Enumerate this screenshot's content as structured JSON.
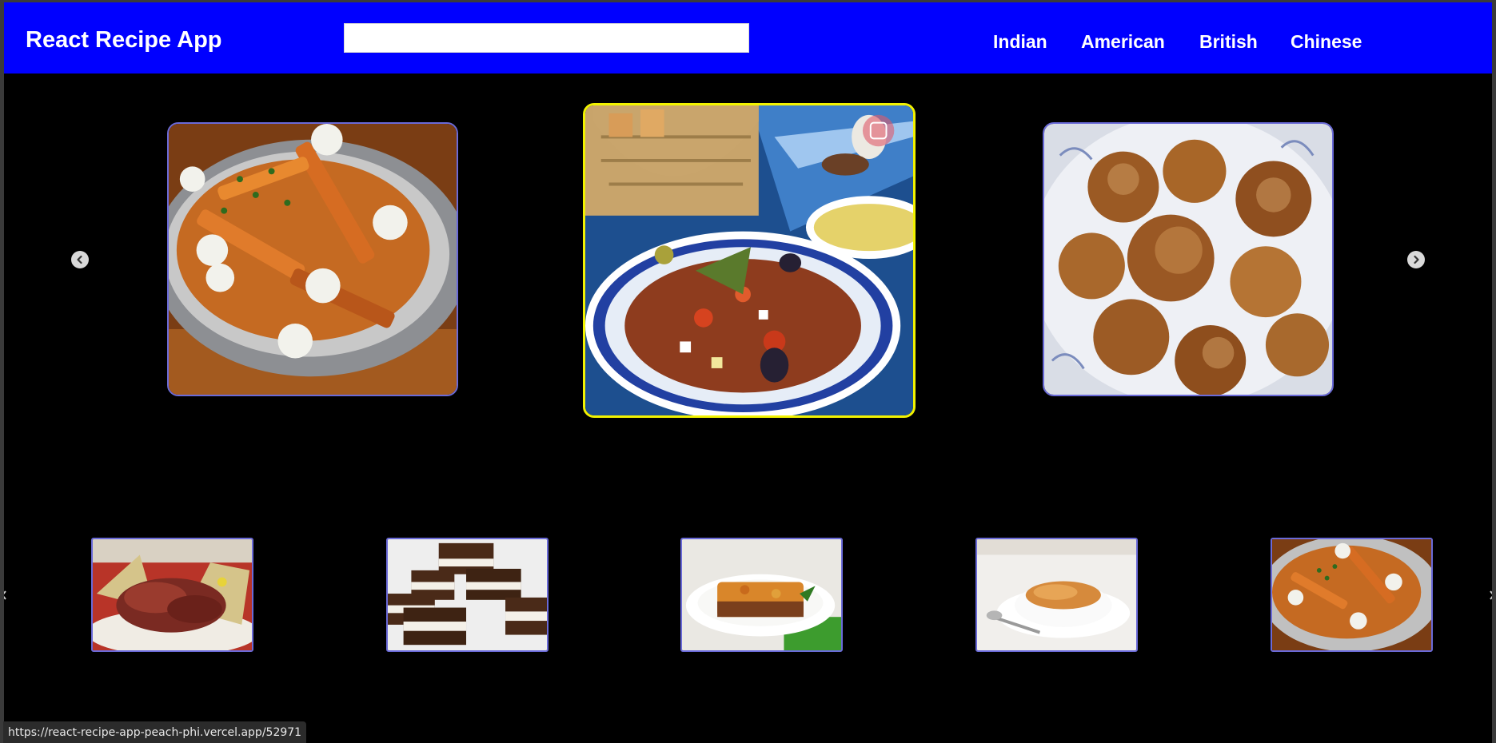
{
  "app": {
    "title": "React Recipe App"
  },
  "search": {
    "value": "",
    "placeholder": ""
  },
  "nav": {
    "links": [
      {
        "label": "Indian"
      },
      {
        "label": "American"
      },
      {
        "label": "British"
      },
      {
        "label": "Chinese"
      }
    ]
  },
  "carousel": {
    "prev_icon": "chevron-left-icon",
    "next_icon": "chevron-right-icon",
    "slides": [
      {
        "dish": "poutine"
      },
      {
        "dish": "tunisian-salad"
      },
      {
        "dish": "sugared-doughnuts"
      }
    ]
  },
  "thumbnails": [
    {
      "dish": "pastrami-sandwich"
    },
    {
      "dish": "nanaimo-bars"
    },
    {
      "dish": "moussaka"
    },
    {
      "dish": "bread-pudding"
    },
    {
      "dish": "poutine"
    }
  ],
  "status_bar": {
    "url": "https://react-recipe-app-peach-phi.vercel.app/52971"
  },
  "colors": {
    "navbar": "#0000ff",
    "background": "#000000",
    "active_border": "#f2f200",
    "card_border": "#6a6ad8"
  }
}
